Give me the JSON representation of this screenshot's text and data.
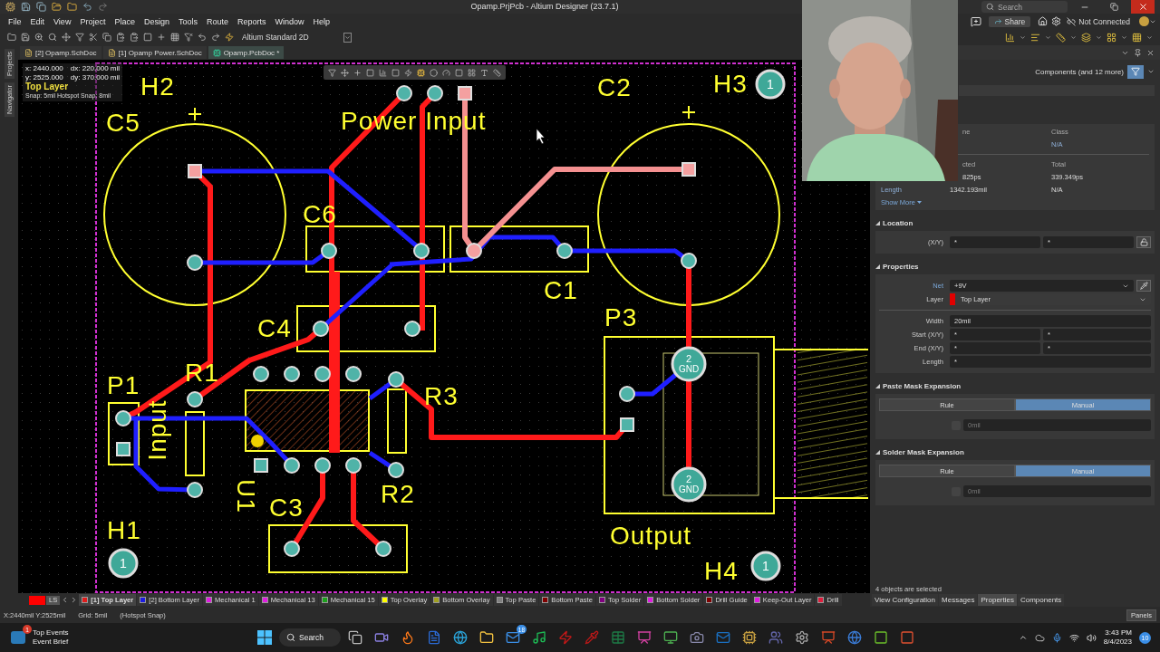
{
  "window": {
    "title": "Opamp.PrjPcb - Altium Designer (23.7.1)",
    "search": {
      "placeholder": "Search"
    }
  },
  "menu": [
    "File",
    "Edit",
    "View",
    "Project",
    "Place",
    "Design",
    "Tools",
    "Route",
    "Reports",
    "Window",
    "Help"
  ],
  "account": {
    "share": "Share",
    "status": "Not Connected"
  },
  "toolbar": {
    "view_mode": "Altium Standard 2D"
  },
  "side_tabs": [
    "Projects",
    "Navigator"
  ],
  "doc_tabs": [
    {
      "label": "[2] Opamp.SchDoc",
      "kind": "schematic",
      "selected": false
    },
    {
      "label": "[1] Opamp Power.SchDoc",
      "kind": "schematic",
      "selected": false
    },
    {
      "label": "Opamp.PcbDoc *",
      "kind": "pcb",
      "selected": true
    }
  ],
  "hover_info": {
    "x": "x: 2440.000",
    "dx": "dx: 220.000 mil",
    "y": "y: 2525.000",
    "dy": "dy: 370.000 mil",
    "layer": "Top Layer",
    "snap": "Snap: 5mil Hotspot Snap: 8mil"
  },
  "pcb": {
    "labels": [
      "H2",
      "C5",
      "Power Input",
      "C2",
      "H3",
      "C6",
      "C1",
      "C4",
      "P3",
      "P1",
      "R1",
      "R3",
      "Input",
      "U1",
      "R2",
      "C3",
      "H1",
      "Output",
      "H4"
    ],
    "hole_numbers": [
      "1",
      "1",
      "1"
    ],
    "pads": [
      {
        "number": "2",
        "net": "GND"
      },
      {
        "number": "2",
        "net": "GND"
      }
    ]
  },
  "webcam": {
    "kind": "picture"
  },
  "panel": {
    "filter": "Components (and 12 more)",
    "summary": {
      "name_head": "ne",
      "class_head": "Class",
      "class_value": "N/A",
      "routed_head": "cted",
      "total_head": "Total",
      "routed_value": "825ps",
      "total_value": "339.349ps",
      "length_label": "Length",
      "length_routed": "1342.193mil",
      "length_total": "N/A",
      "show_more": "Show More"
    },
    "location": {
      "title": "Location",
      "label": "(X/Y)",
      "x": "*",
      "y": "*"
    },
    "properties": {
      "title": "Properties",
      "net_label": "Net",
      "net": "+9V",
      "layer_label": "Layer",
      "layer": "Top Layer",
      "width_label": "Width",
      "width": "20mil",
      "start_label": "Start (X/Y)",
      "start_x": "*",
      "start_y": "*",
      "end_label": "End (X/Y)",
      "end_x": "*",
      "end_y": "*",
      "length_label": "Length",
      "length": "*"
    },
    "masks": [
      {
        "title": "Paste Mask Expansion",
        "options": [
          {
            "label": "Rule",
            "selected": false
          },
          {
            "label": "Manual",
            "selected": true
          }
        ],
        "checked": false,
        "value": "0mil"
      },
      {
        "title": "Solder Mask Expansion",
        "options": [
          {
            "label": "Rule",
            "selected": false
          },
          {
            "label": "Manual",
            "selected": true
          }
        ],
        "checked": false,
        "value": "0mil"
      }
    ],
    "selection": "4 objects are selected",
    "tabs": [
      {
        "label": "View Configuration",
        "selected": false
      },
      {
        "label": "Messages",
        "selected": false
      },
      {
        "label": "Properties",
        "selected": true
      },
      {
        "label": "Components",
        "selected": false
      }
    ]
  },
  "layer_bar": {
    "ls": "LS",
    "tabs": [
      {
        "label": "[1] Top Layer",
        "color": "#e01c1c",
        "selected": true
      },
      {
        "label": "[2] Bottom Layer",
        "color": "#1c1ce0",
        "selected": false
      },
      {
        "label": "Mechanical 1",
        "color": "#e01ce0",
        "selected": false
      },
      {
        "label": "Mechanical 13",
        "color": "#e01ce0",
        "selected": false
      },
      {
        "label": "Mechanical 15",
        "color": "#1ca01c",
        "selected": false
      },
      {
        "label": "Top Overlay",
        "color": "#ffff00",
        "selected": false
      },
      {
        "label": "Bottom Overlay",
        "color": "#a0a020",
        "selected": false
      },
      {
        "label": "Top Paste",
        "color": "#808080",
        "selected": false
      },
      {
        "label": "Bottom Paste",
        "color": "#800000",
        "selected": false
      },
      {
        "label": "Top Solder",
        "color": "#800080",
        "selected": false
      },
      {
        "label": "Bottom Solder",
        "color": "#e01ce0",
        "selected": false
      },
      {
        "label": "Drill Guide",
        "color": "#800000",
        "selected": false
      },
      {
        "label": "Keep-Out Layer",
        "color": "#e01ce0",
        "selected": false
      },
      {
        "label": "Drill",
        "color": "#e01c3c",
        "selected": false
      }
    ]
  },
  "status_bar": {
    "position": "X:2440mil Y:2525mil",
    "grid": "Grid: 5mil",
    "snap": "(Hotspot Snap)",
    "panels": "Panels"
  },
  "taskbar": {
    "widget_badge": "1",
    "widget_title": "Top Events",
    "widget_subtitle": "Event Brief",
    "search": "Search",
    "mail_badge": "18",
    "time": "3:43 PM",
    "date": "8/4/2023",
    "notifications": "10"
  }
}
